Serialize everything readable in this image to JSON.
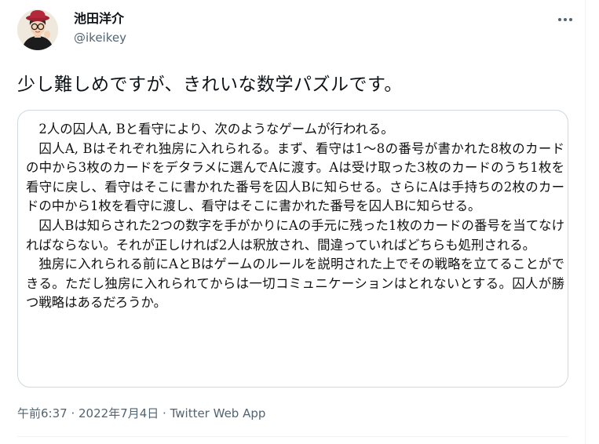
{
  "author": {
    "display_name": "池田洋介",
    "handle": "@ikeikey"
  },
  "tweet": {
    "text": "少し難しめですが、きれいな数学パズルです。"
  },
  "image_text": {
    "paragraphs": [
      "2人の囚人A, Bと看守により、次のようなゲームが行われる。",
      "囚人A, Bはそれぞれ独房に入れられる。まず、看守は1〜8の番号が書かれた8枚のカードの中から3枚のカードをデタラメに選んでAに渡す。Aは受け取った3枚のカードのうち1枚を看守に戻し、看守はそこに書かれた番号を囚人Bに知らせる。さらにAは手持ちの2枚のカードの中から1枚を看守に渡し、看守はそこに書かれた番号を囚人Bに知らせる。",
      "囚人Bは知らされた2つの数字を手がかりにAの手元に残った1枚のカードの番号を当てなければならない。それが正しければ2人は釈放され、間違っていればどちらも処刑される。",
      "独房に入れられる前にAとBはゲームのルールを説明された上でその戦略を立てることができる。ただし独房に入れられてからは一切コミュニケーションはとれないとする。囚人が勝つ戦略はあるだろうか。"
    ]
  },
  "meta": {
    "time": "午前6:37",
    "sep1": " · ",
    "date": "2022年7月4日",
    "sep2": " · ",
    "source": "Twitter Web App"
  },
  "icons": {
    "more": "more-horizontal-icon",
    "avatar": "user-avatar"
  },
  "colors": {
    "text_primary": "#0f1419",
    "text_secondary": "#536471",
    "border": "#cfd9de"
  }
}
